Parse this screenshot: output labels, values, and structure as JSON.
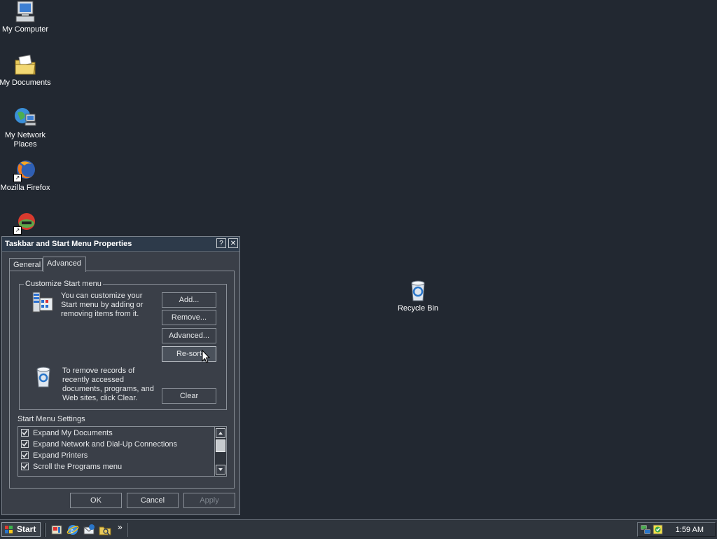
{
  "desktop": {
    "icons": [
      {
        "label": "My Computer",
        "icon": "computer-icon"
      },
      {
        "label": "My Documents",
        "icon": "documents-folder-icon"
      },
      {
        "label": "My Network Places",
        "icon": "network-places-icon"
      },
      {
        "label": "Mozilla Firefox",
        "icon": "firefox-icon"
      },
      {
        "label": "",
        "icon": "app-shortcut-icon"
      },
      {
        "label": "Recycle Bin",
        "icon": "recycle-bin-icon"
      }
    ]
  },
  "dialog": {
    "title": "Taskbar and Start Menu Properties",
    "help_button": "?",
    "close_button": "✕",
    "tabs": [
      {
        "label": "General",
        "active": false
      },
      {
        "label": "Advanced",
        "active": true
      }
    ],
    "customize_group": {
      "title": "Customize Start menu",
      "description": "You can customize your Start menu by adding or removing items from it.",
      "buttons": {
        "add": "Add...",
        "remove": "Remove...",
        "advanced": "Advanced...",
        "resort": "Re-sort"
      },
      "clear_description": "To remove records of recently accessed documents, programs, and Web sites,  click Clear.",
      "clear_button": "Clear"
    },
    "settings": {
      "title": "Start Menu Settings",
      "items": [
        {
          "label": "Expand My Documents",
          "checked": true
        },
        {
          "label": "Expand Network and Dial-Up Connections",
          "checked": true
        },
        {
          "label": "Expand Printers",
          "checked": true
        },
        {
          "label": "Scroll the Programs menu",
          "checked": true
        }
      ]
    },
    "footer": {
      "ok": "OK",
      "cancel": "Cancel",
      "apply": "Apply"
    }
  },
  "taskbar": {
    "start_label": "Start",
    "chevron": "»",
    "clock": "1:59 AM"
  }
}
